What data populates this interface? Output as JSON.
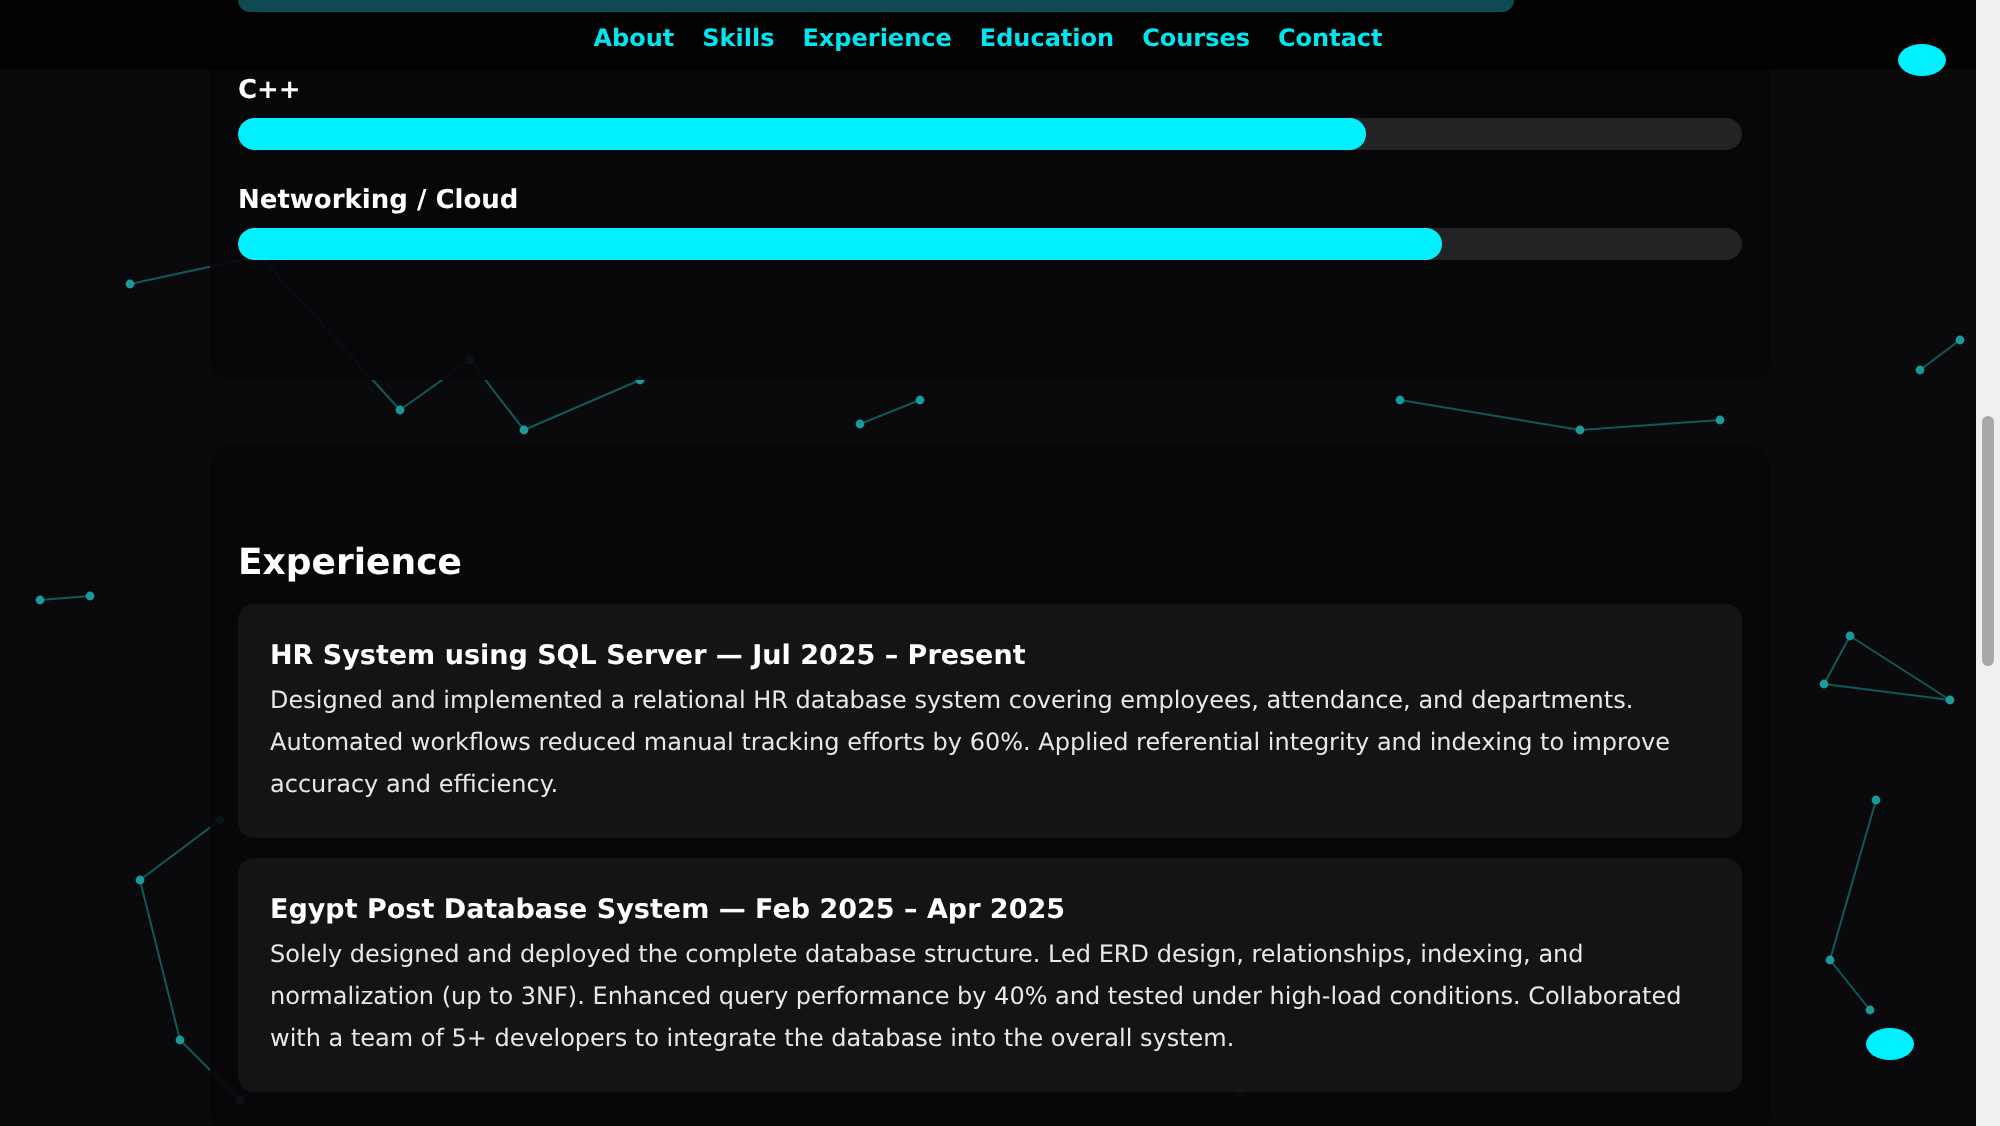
{
  "nav": {
    "links": [
      {
        "label": "About"
      },
      {
        "label": "Skills"
      },
      {
        "label": "Experience"
      },
      {
        "label": "Education"
      },
      {
        "label": "Courses"
      },
      {
        "label": "Contact"
      }
    ]
  },
  "skills": [
    {
      "name": "C++",
      "level": 0.75
    },
    {
      "name": "Networking / Cloud",
      "level": 0.8
    }
  ],
  "experience": {
    "title": "Experience",
    "items": [
      {
        "title": "HR System using SQL Server — Jul 2025 – Present",
        "description": "Designed and implemented a relational HR database system covering employees, attendance, and departments. Automated workflows reduced manual tracking efforts by 60%. Applied referential integrity and indexing to improve accuracy and efficiency."
      },
      {
        "title": "Egypt Post Database System — Feb 2025 – Apr 2025",
        "description": "Solely designed and deployed the complete database structure. Led ERD design, relationships, indexing, and normalization (up to 3NF). Enhanced query performance by 40% and tested under high-load conditions. Collaborated with a team of 5+ developers to integrate the database into the overall system."
      }
    ]
  }
}
